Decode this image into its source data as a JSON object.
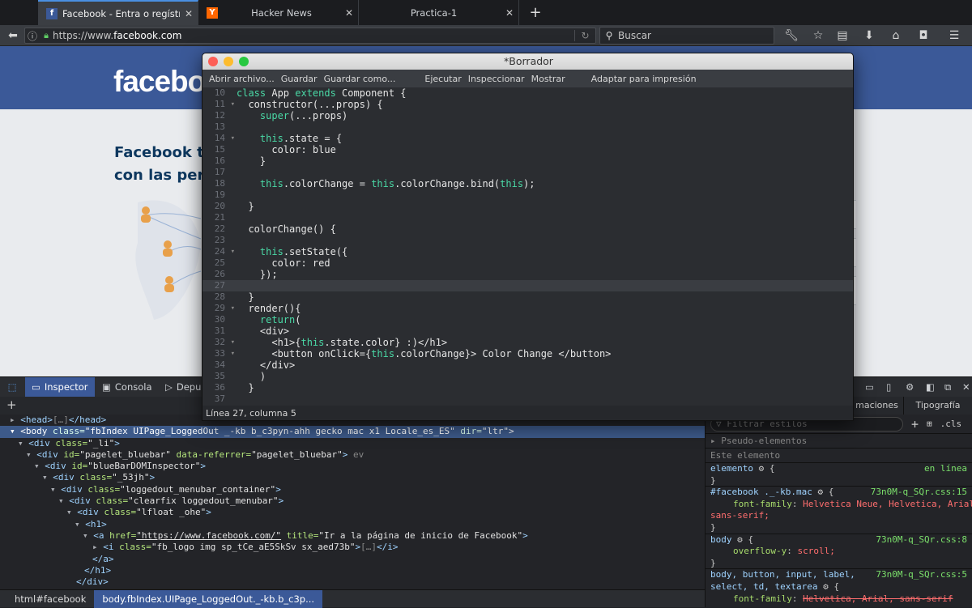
{
  "browser": {
    "tabs": [
      {
        "title": "Facebook - Entra o regístrate",
        "favicon": "f",
        "active": true
      },
      {
        "title": "Hacker News",
        "favicon": "Y",
        "active": false
      },
      {
        "title": "Practica-1",
        "favicon": "",
        "active": false
      }
    ],
    "new_tab": "+",
    "url_prefix": "https://www.",
    "url_domain": "facebook",
    "url_suffix": ".com",
    "search_placeholder": "Buscar"
  },
  "page": {
    "logo": "facebook",
    "tagline_line1": "Facebook te",
    "tagline_line2": "con las pers"
  },
  "editor": {
    "title": "*Borrador",
    "toolbar": [
      "Abrir archivo...",
      "Guardar",
      "Guardar como...",
      "Ejecutar",
      "Inspeccionar",
      "Mostrar",
      "Adaptar para impresión"
    ],
    "line_numbers": [
      "10",
      "11",
      "12",
      "13",
      "14",
      "15",
      "16",
      "17",
      "18",
      "19",
      "20",
      "21",
      "22",
      "23",
      "24",
      "25",
      "26",
      "27",
      "28",
      "29",
      "30",
      "31",
      "32",
      "33",
      "34",
      "35",
      "36",
      "37"
    ],
    "status": "Línea 27, columna 5"
  },
  "devtools": {
    "tabs": [
      "Inspector",
      "Consola",
      "Depu"
    ],
    "right_tabs": [
      "maciones",
      "Tipografía"
    ],
    "breadcrumbs": [
      "html#facebook",
      "body.fbIndex.UIPage_LoggedOut._-kb.b_c3p..."
    ],
    "filter_placeholder": "Filtrar estilos",
    "pseudo": "Pseudo-elementos",
    "this_element": "Este elemento",
    "element_label": "elemento",
    "inline": "en línea",
    "cls": ".cls",
    "rules": [
      {
        "selector": "#facebook ._-kb.mac",
        "source": "73n0M-q_SQr.css:15",
        "props": [
          [
            "font-family",
            "Helvetica Neue, Helvetica, Arial,"
          ],
          [
            "",
            "sans-serif;"
          ]
        ]
      },
      {
        "selector": "body",
        "source": "73n0M-q_SQr.css:8",
        "props": [
          [
            "overflow-y",
            "scroll;"
          ]
        ]
      },
      {
        "selector": "body, button, input, label,",
        "source": "73n0M-q_SQr.css:5",
        "selector2": "select, td, textarea",
        "props": [
          [
            "font-family",
            "Helvetica, Arial, sans-serif"
          ]
        ]
      }
    ]
  }
}
